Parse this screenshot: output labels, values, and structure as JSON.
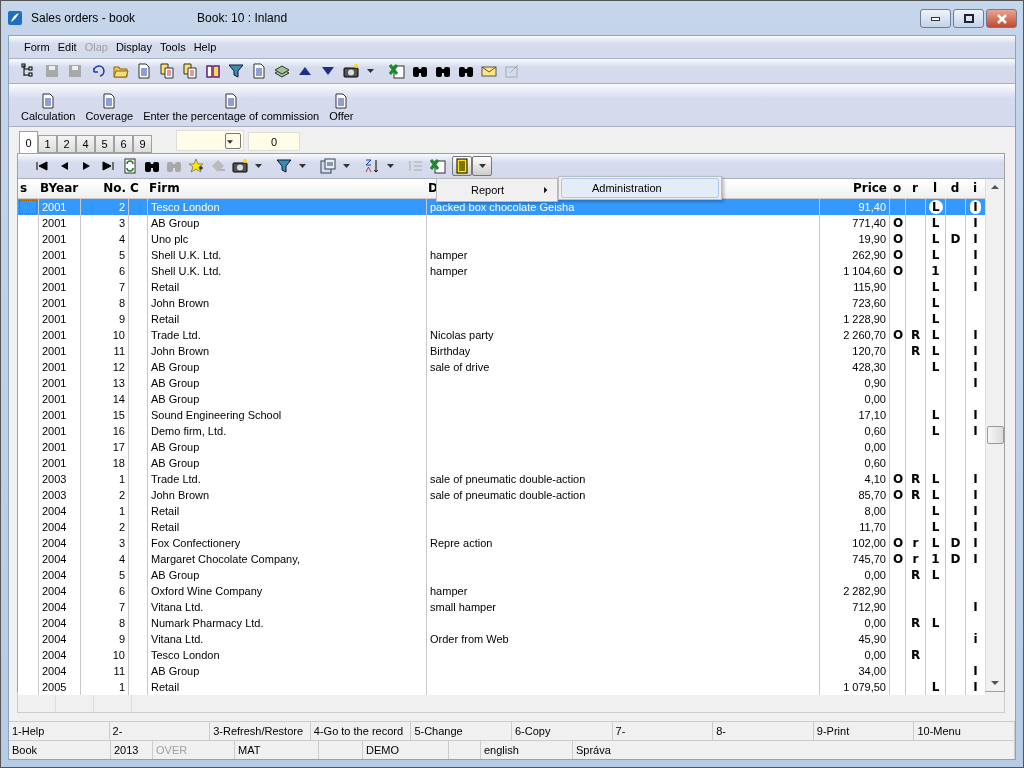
{
  "window": {
    "title": "Sales orders - book",
    "subtitle": "Book: 10 : Inland"
  },
  "menu": [
    {
      "label": "Form",
      "disabled": false
    },
    {
      "label": "Edit",
      "disabled": false
    },
    {
      "label": "Olap",
      "disabled": true
    },
    {
      "label": "Display",
      "disabled": false
    },
    {
      "label": "Tools",
      "disabled": false
    },
    {
      "label": "Help",
      "disabled": false
    }
  ],
  "commands": [
    "Calculation",
    "Coverage",
    "Enter the percentage of commission",
    "Offer"
  ],
  "tabs": [
    {
      "label": "0",
      "selected": true
    },
    {
      "label": "1",
      "selected": false
    },
    {
      "label": "2",
      "selected": false
    },
    {
      "label": "4",
      "selected": false
    },
    {
      "label": "5",
      "selected": false
    },
    {
      "label": "6",
      "selected": false
    },
    {
      "label": "9",
      "selected": false
    }
  ],
  "number_field": {
    "value": "0"
  },
  "popup_menu": {
    "item": "Report",
    "submenu": [
      "Administration"
    ]
  },
  "table": {
    "columns": [
      "s",
      "BYear",
      "No.",
      "C",
      "Firm",
      "D",
      "Price",
      "o",
      "r",
      "l",
      "d",
      "i"
    ],
    "rows": [
      {
        "byear": "2001",
        "no": "2",
        "firm": "Tesco London",
        "column_6": "packed box chocolate Geisha",
        "price": "91,40",
        "l": "L",
        "i": "I",
        "selected": true
      },
      {
        "byear": "2001",
        "no": "3",
        "firm": "AB Group",
        "price": "771,40",
        "o": "O",
        "l": "L",
        "i": "I",
        "selected": false
      },
      {
        "byear": "2001",
        "no": "4",
        "firm": "Uno plc",
        "price": "19,90",
        "o": "O",
        "l": "L",
        "d": "D",
        "i": "I",
        "selected": false
      },
      {
        "byear": "2001",
        "no": "5",
        "firm": "Shell U.K. Ltd.",
        "column_6": "hamper",
        "price": "262,90",
        "o": "O",
        "l": "L",
        "i": "I",
        "selected": false
      },
      {
        "byear": "2001",
        "no": "6",
        "firm": "Shell U.K. Ltd.",
        "column_6": "hamper",
        "price": "1 104,60",
        "o": "O",
        "l": "1",
        "i": "I",
        "selected": false
      },
      {
        "byear": "2001",
        "no": "7",
        "firm": "Retail",
        "price": "115,90",
        "l": "L",
        "i": "I",
        "selected": false
      },
      {
        "byear": "2001",
        "no": "8",
        "firm": "John Brown",
        "price": "723,60",
        "l": "L",
        "selected": false
      },
      {
        "byear": "2001",
        "no": "9",
        "firm": "Retail",
        "price": "1 228,90",
        "l": "L",
        "selected": false
      },
      {
        "byear": "2001",
        "no": "10",
        "firm": "Trade Ltd.",
        "column_6": "Nicolas party",
        "price": "2 260,70",
        "o": "O",
        "r": "R",
        "l": "L",
        "i": "I",
        "selected": false
      },
      {
        "byear": "2001",
        "no": "11",
        "firm": "John Brown",
        "column_6": "Birthday",
        "price": "120,70",
        "r": "R",
        "l": "L",
        "i": "I",
        "selected": false
      },
      {
        "byear": "2001",
        "no": "12",
        "firm": "AB Group",
        "column_6": "sale of drive",
        "price": "428,30",
        "l": "L",
        "i": "I",
        "selected": false
      },
      {
        "byear": "2001",
        "no": "13",
        "firm": "AB Group",
        "price": "0,90",
        "i": "I",
        "selected": false
      },
      {
        "byear": "2001",
        "no": "14",
        "firm": "AB Group",
        "price": "0,00",
        "selected": false
      },
      {
        "byear": "2001",
        "no": "15",
        "firm": "Sound Engineering School",
        "price": "17,10",
        "l": "L",
        "i": "I",
        "selected": false
      },
      {
        "byear": "2001",
        "no": "16",
        "firm": "Demo firm, Ltd.",
        "price": "0,60",
        "l": "L",
        "i": "I",
        "selected": false
      },
      {
        "byear": "2001",
        "no": "17",
        "firm": "AB Group",
        "price": "0,00",
        "selected": false
      },
      {
        "byear": "2001",
        "no": "18",
        "firm": "AB Group",
        "price": "0,60",
        "selected": false
      },
      {
        "byear": "2003",
        "no": "1",
        "firm": "Trade Ltd.",
        "column_6": "sale of pneumatic double-action",
        "price": "4,10",
        "o": "O",
        "r": "R",
        "l": "L",
        "i": "I",
        "selected": false
      },
      {
        "byear": "2003",
        "no": "2",
        "firm": "John Brown",
        "column_6": "sale of pneumatic double-action",
        "price": "85,70",
        "o": "O",
        "r": "R",
        "l": "L",
        "i": "I",
        "selected": false
      },
      {
        "byear": "2004",
        "no": "1",
        "firm": "Retail",
        "price": "8,00",
        "l": "L",
        "i": "I",
        "selected": false
      },
      {
        "byear": "2004",
        "no": "2",
        "firm": "Retail",
        "price": "11,70",
        "l": "L",
        "i": "I",
        "selected": false
      },
      {
        "byear": "2004",
        "no": "3",
        "firm": "Fox Confectionery",
        "column_6": "Repre action",
        "price": "102,00",
        "o": "O",
        "r": "r",
        "l": "L",
        "d": "D",
        "i": "I",
        "selected": false
      },
      {
        "byear": "2004",
        "no": "4",
        "firm": "Margaret Chocolate Company,",
        "price": "745,70",
        "o": "O",
        "r": "r",
        "l": "1",
        "d": "D",
        "i": "I",
        "selected": false
      },
      {
        "byear": "2004",
        "no": "5",
        "firm": "AB Group",
        "price": "0,00",
        "r": "R",
        "l": "L",
        "selected": false
      },
      {
        "byear": "2004",
        "no": "6",
        "firm": "Oxford Wine Company",
        "column_6": "hamper",
        "price": "2 282,90",
        "selected": false
      },
      {
        "byear": "2004",
        "no": "7",
        "firm": "Vitana Ltd.",
        "column_6": "small hamper",
        "price": "712,90",
        "i": "I",
        "selected": false
      },
      {
        "byear": "2004",
        "no": "8",
        "firm": "Numark Pharmacy Ltd.",
        "price": "0,00",
        "r": "R",
        "l": "L",
        "selected": false
      },
      {
        "byear": "2004",
        "no": "9",
        "firm": "Vitana Ltd.",
        "column_6": "Order from Web",
        "price": "45,90",
        "i": "i",
        "selected": false
      },
      {
        "byear": "2004",
        "no": "10",
        "firm": "Tesco London",
        "price": "0,00",
        "r": "R",
        "selected": false
      },
      {
        "byear": "2004",
        "no": "11",
        "firm": "AB Group",
        "price": "34,00",
        "i": "I",
        "selected": false
      },
      {
        "byear": "2005",
        "no": "1",
        "firm": "Retail",
        "price": "1 079,50",
        "l": "L",
        "i": "I",
        "selected": false
      }
    ]
  },
  "function_keys": [
    "1-Help",
    "2-",
    "3-Refresh/Restore",
    "4-Go to the record",
    "5-Change",
    "6-Copy",
    "7-",
    "8-",
    "9-Print",
    "10-Menu"
  ],
  "status_bar": [
    {
      "text": "Book",
      "disabled": false
    },
    {
      "text": "2013",
      "disabled": false
    },
    {
      "text": "OVER",
      "disabled": true
    },
    {
      "text": "MAT",
      "disabled": false
    },
    {
      "text": "DEMO",
      "disabled": false
    },
    {
      "text": "english",
      "disabled": false
    },
    {
      "text": "Správa",
      "disabled": false
    }
  ]
}
